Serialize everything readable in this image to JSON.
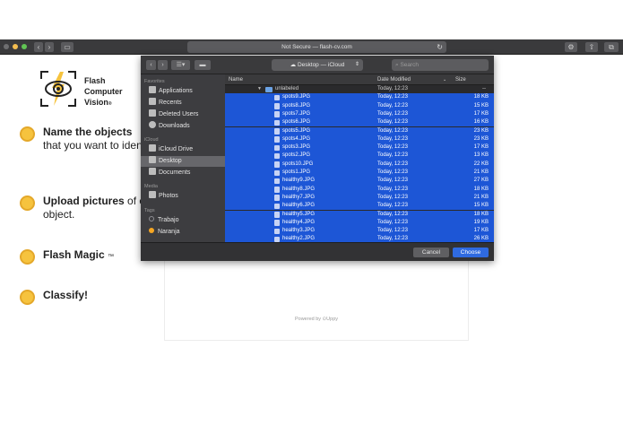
{
  "browser": {
    "url": "Not Secure — flash-cv.com",
    "reload_icon": "reload-icon",
    "nav_back_icon": "chevron-left-icon",
    "nav_forward_icon": "chevron-right-icon"
  },
  "logo": {
    "line1": "Flash",
    "line2": "Computer",
    "line3": "Vision",
    "mark": "®",
    "icon": "eye-bolt-logo-icon",
    "accent": "#f6c33e"
  },
  "steps": [
    {
      "bold": "Name the objects",
      "rest": "that you want to identify."
    },
    {
      "bold": "Upload pictures",
      "rest": "of each object."
    },
    {
      "bold": "Flash Magic",
      "tm": "™",
      "rest": ""
    },
    {
      "bold": "Classify!",
      "rest": ""
    }
  ],
  "dropzone": {
    "powered_by": "Powered by ⊙Uppy"
  },
  "dialog": {
    "location": "Desktop — iCloud",
    "search_placeholder": "Search",
    "sidebar": {
      "favorites_heading": "Favorites",
      "favorites": [
        "Applications",
        "Recents",
        "Deleted Users",
        "Downloads"
      ],
      "icloud_heading": "iCloud",
      "icloud": [
        "iCloud Drive",
        "Desktop",
        "Documents"
      ],
      "media_heading": "Media",
      "media": [
        "Photos"
      ],
      "tags_heading": "Tags",
      "tags": [
        {
          "label": "Trabajo",
          "color": "#8e8e93"
        },
        {
          "label": "Naranja",
          "color": "#f5a623"
        }
      ]
    },
    "columns": {
      "name": "Name",
      "date": "Date Modified",
      "size": "Size"
    },
    "folder": {
      "name": "unlabeled",
      "date": "Today, 12:23",
      "size": "--"
    },
    "files": [
      {
        "name": "spots9.JPG",
        "date": "Today, 12:23",
        "size": "18 KB"
      },
      {
        "name": "spots8.JPG",
        "date": "Today, 12:23",
        "size": "15 KB"
      },
      {
        "name": "spots7.JPG",
        "date": "Today, 12:23",
        "size": "17 KB"
      },
      {
        "name": "spots6.JPG",
        "date": "Today, 12:23",
        "size": "16 KB"
      },
      {
        "name": "spots5.JPG",
        "date": "Today, 12:23",
        "size": "23 KB"
      },
      {
        "name": "spots4.JPG",
        "date": "Today, 12:23",
        "size": "23 KB"
      },
      {
        "name": "spots3.JPG",
        "date": "Today, 12:23",
        "size": "17 KB"
      },
      {
        "name": "spots2.JPG",
        "date": "Today, 12:23",
        "size": "13 KB"
      },
      {
        "name": "spots10.JPG",
        "date": "Today, 12:23",
        "size": "22 KB"
      },
      {
        "name": "spots1.JPG",
        "date": "Today, 12:23",
        "size": "21 KB"
      },
      {
        "name": "healthy9.JPG",
        "date": "Today, 12:23",
        "size": "27 KB"
      },
      {
        "name": "healthy8.JPG",
        "date": "Today, 12:23",
        "size": "18 KB"
      },
      {
        "name": "healthy7.JPG",
        "date": "Today, 12:23",
        "size": "21 KB"
      },
      {
        "name": "healthy6.JPG",
        "date": "Today, 12:23",
        "size": "15 KB"
      },
      {
        "name": "healthy5.JPG",
        "date": "Today, 12:23",
        "size": "18 KB"
      },
      {
        "name": "healthy4.JPG",
        "date": "Today, 12:23",
        "size": "19 KB"
      },
      {
        "name": "healthy3.JPG",
        "date": "Today, 12:23",
        "size": "17 KB"
      },
      {
        "name": "healthy2.JPG",
        "date": "Today, 12:23",
        "size": "26 KB"
      }
    ],
    "cancel_label": "Cancel",
    "choose_label": "Choose",
    "selection_color": "#1d56d6"
  }
}
